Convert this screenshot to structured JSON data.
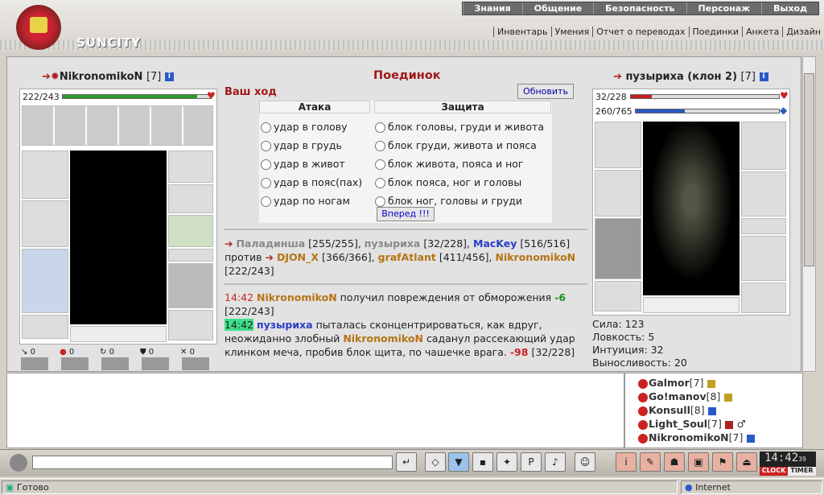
{
  "top_nav": [
    "Знания",
    "Общение",
    "Безопасность",
    "Персонаж",
    "Выход"
  ],
  "sub_nav": [
    "Инвентарь",
    "Умения",
    "Отчет о переводах",
    "Поединки",
    "Анкета",
    "Дизайн"
  ],
  "logo_text": "SUNCITY",
  "left_player": {
    "name": "NikronomikoN",
    "level": "[7]",
    "hp_text": "222/243",
    "hp_fraction": 0.91
  },
  "right_player": {
    "name": "пузыриха (клон 2)",
    "level": "[7]",
    "hp_text": "32/228",
    "hp_fraction": 0.14,
    "mana_text": "260/765",
    "mana_fraction": 0.34
  },
  "title": "Поединок",
  "your_turn": "Ваш ход",
  "refresh_label": "Обновить",
  "attack_header": "Атака",
  "defense_header": "Защита",
  "attacks": [
    "удар в голову",
    "удар в грудь",
    "удар в живот",
    "удар в пояс(пах)",
    "удар по ногам"
  ],
  "defenses": [
    "блок головы, груди и живота",
    "блок груди, живота и пояса",
    "блок живота, пояса и ног",
    "блок пояса, ног и головы",
    "блок ног, головы и груди"
  ],
  "forward_label": "Вперед !!!",
  "teams": {
    "p1": "Паладинша",
    "p1_hp": "[255/255],",
    "p2": "пузыриха",
    "p2_hp": "[32/228],",
    "p3": "MacKey",
    "p3_hp": "[516/516]",
    "vs": "против",
    "p4": "DJON_X",
    "p4_hp": "[366/366],",
    "p5": "grafAtlant",
    "p5_hp": "[411/456],",
    "p6": "NikronomikoN",
    "p6_hp": "[222/243]"
  },
  "log": {
    "t1": "14:42",
    "n1": "NikronomikoN",
    "m1": "получил повреждения от обморожения",
    "d1": "-6",
    "h1": "[222/243]",
    "t2": "14:42",
    "n2": "пузыриха",
    "m2a": "пыталась сконцентрироваться, как вдруг, неожиданно злобный",
    "n2b": "NikronomikoN",
    "m2b": "саданул рассекающий удар клинком меча, пробив блок щита, по чашечке врага.",
    "d2": "-98",
    "h2": "[32/228]"
  },
  "stats": [
    "Сила: 123",
    "Ловкость: 5",
    "Интуиция: 32",
    "Выносливость: 20"
  ],
  "left_counters": [
    "0",
    "0",
    "0",
    "0",
    "0"
  ],
  "users": [
    {
      "name": "Galmor",
      "level": "[7]"
    },
    {
      "name": "Go!manov",
      "level": "[8]"
    },
    {
      "name": "Konsull",
      "level": "[8]"
    },
    {
      "name": "Light_Soul",
      "level": "[7]"
    },
    {
      "name": "NikronomikoN",
      "level": "[7]"
    }
  ],
  "clock": {
    "time": "14:42",
    "sec": "39",
    "label1": "CLOCK",
    "label2": "TIMER"
  },
  "statusbar": {
    "ready": "Готово",
    "zone": "Internet"
  }
}
